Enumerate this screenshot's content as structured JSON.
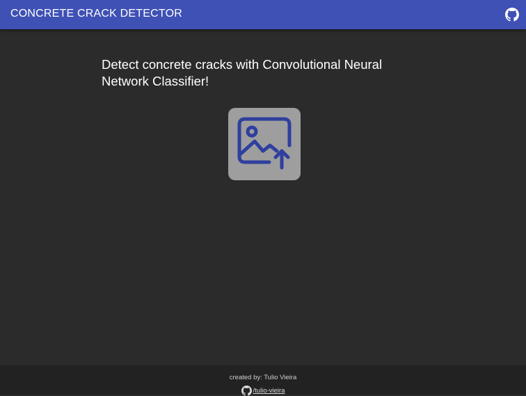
{
  "appbar": {
    "title": "CONCRETE CRACK DETECTOR",
    "github_icon": "github-icon",
    "color": "#3f51b5"
  },
  "main": {
    "headline": "Detect concrete cracks with Convolutional Neural Network Classifier!",
    "upload_icon": "image-upload-icon"
  },
  "footer": {
    "credit": "created by: Tulio Vieira",
    "github_icon": "github-icon",
    "github_handle": "/tulio-vieira"
  }
}
